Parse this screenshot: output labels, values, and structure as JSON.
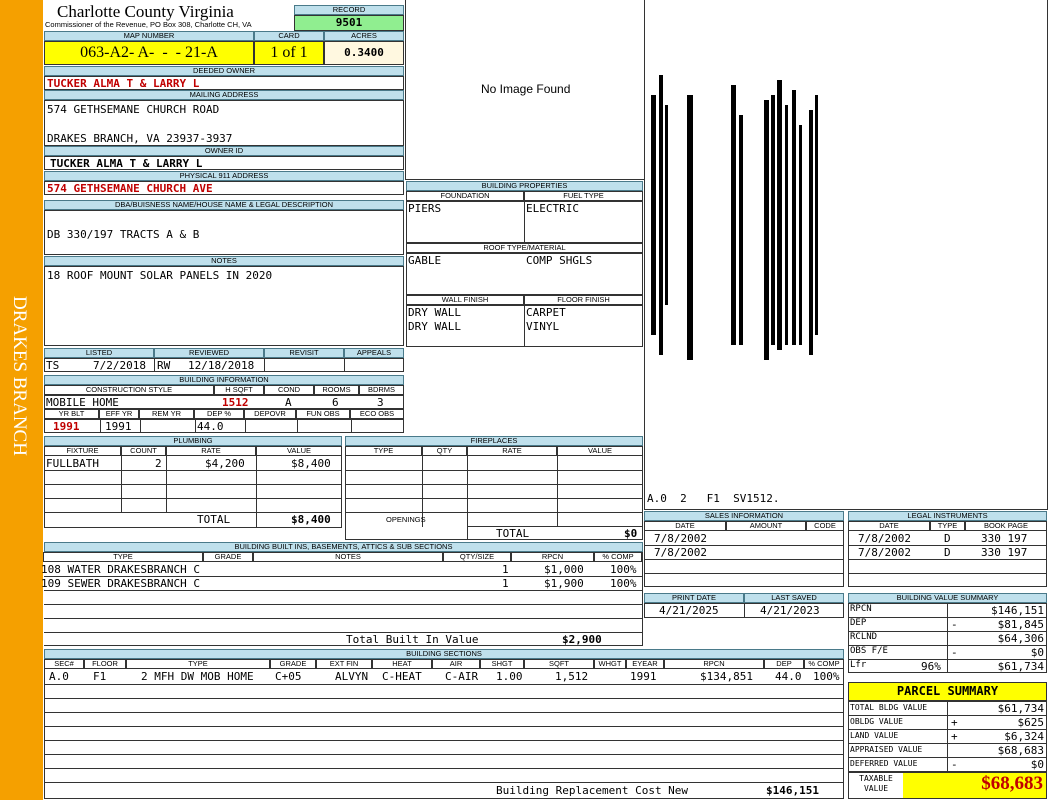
{
  "sidebar": {
    "text": "DRAKES BRANCH"
  },
  "county": {
    "title": "Charlotte County Virginia",
    "subtitle": "Commissioner of the Revenue, PO Box 308, Charlotte CH, VA"
  },
  "record": {
    "label": "RECORD",
    "value": "9501"
  },
  "map": {
    "label": "MAP NUMBER",
    "value": "063-A2- A-  -  - 21-A"
  },
  "card": {
    "label": "CARD",
    "value": "1 of 1"
  },
  "acres": {
    "label": "ACRES",
    "value": "0.3400"
  },
  "deeded_owner": {
    "label": "DEEDED OWNER",
    "value": "TUCKER ALMA T & LARRY L"
  },
  "mailing": {
    "label": "MAILING ADDRESS",
    "line1": "574 GETHSEMANE CHURCH ROAD",
    "line2": "DRAKES BRANCH, VA 23937-3937"
  },
  "owner_id": {
    "label": "OWNER ID",
    "value": "TUCKER ALMA T & LARRY L"
  },
  "physical": {
    "label": "PHYSICAL 911 ADDRESS",
    "value": "574 GETHSEMANE CHURCH AVE"
  },
  "legal": {
    "label": "DBA/BUISNESS NAME/HOUSE NAME & LEGAL DESCRIPTION",
    "value": "DB 330/197 TRACTS A & B"
  },
  "notes": {
    "label": "NOTES",
    "value": "18 ROOF MOUNT SOLAR PANELS IN 2020"
  },
  "photo": {
    "text": "No Image Found"
  },
  "building_props": {
    "label": "BUILDING PROPERTIES",
    "foundation_label": "FOUNDATION",
    "fuel_label": "FUEL TYPE",
    "foundation": "PIERS",
    "fuel": "ELECTRIC",
    "roof_label": "ROOF TYPE/MATERIAL",
    "roof_type": "GABLE",
    "roof_material": "COMP SHGLS",
    "wall_label": "WALL FINISH",
    "floor_label": "FLOOR FINISH",
    "walls": [
      "DRY WALL",
      "DRY WALL"
    ],
    "floors": [
      "CARPET",
      "VINYL"
    ]
  },
  "sketch": {
    "caption": "A.0  2   F1  SV1512."
  },
  "listed": {
    "label_listed": "LISTED",
    "label_reviewed": "REVIEWED",
    "label_revisit": "REVISIT",
    "label_appeals": "APPEALS",
    "listed_by": "TS",
    "listed_date": "7/2/2018",
    "reviewed_by": "RW",
    "reviewed_date": "12/18/2018"
  },
  "bldg_info": {
    "label": "BUILDING INFORMATION",
    "h_style": "CONSTRUCTION STYLE",
    "h_sqft": "H SQFT",
    "h_cond": "COND",
    "h_rooms": "ROOMS",
    "h_bdrms": "BDRMS",
    "style": "MOBILE HOME",
    "sqft": "1512",
    "cond": "A",
    "rooms": "6",
    "bdrms": "3",
    "h_yrblt": "YR BLT",
    "h_effyr": "EFF YR",
    "h_remyr": "REM YR",
    "h_dep": "DEP %",
    "h_depovr": "DEPOVR",
    "h_funobs": "FUN OBS",
    "h_ecoobs": "ECO OBS",
    "yrblt": "1991",
    "effyr": "1991",
    "dep": "44.0"
  },
  "plumbing": {
    "label": "PLUMBING",
    "headers": [
      "FIXTURE",
      "COUNT",
      "RATE",
      "VALUE"
    ],
    "rows": [
      {
        "fixture": "FULLBATH",
        "count": "2",
        "rate": "$4,200",
        "value": "$8,400"
      }
    ],
    "total_label": "TOTAL",
    "total": "$8,400"
  },
  "fireplaces": {
    "label": "FIREPLACES",
    "headers": [
      "TYPE",
      "QTY",
      "RATE",
      "VALUE"
    ],
    "openings_label": "OPENINGS",
    "total_label": "TOTAL",
    "total": "$0"
  },
  "sales": {
    "label": "SALES INFORMATION",
    "headers": [
      "DATE",
      "AMOUNT",
      "CODE"
    ],
    "rows": [
      {
        "date": "7/8/2002"
      },
      {
        "date": "7/8/2002"
      }
    ]
  },
  "legal_instr": {
    "label": "LEGAL INSTRUMENTS",
    "headers": [
      "DATE",
      "TYPE",
      "BOOK PAGE"
    ],
    "rows": [
      {
        "date": "7/8/2002",
        "type": "D",
        "book": "330 197"
      },
      {
        "date": "7/8/2002",
        "type": "D",
        "book": "330 197"
      }
    ]
  },
  "builtins": {
    "label": "BUILDING BUILT INS, BASEMENTS, ATTICS & SUB SECTIONS",
    "headers": [
      "TYPE",
      "GRADE",
      "NOTES",
      "QTY/SIZE",
      "RPCN",
      "% COMP"
    ],
    "rows": [
      {
        "type": "108 WATER DRAKESBRANCH C",
        "qty": "1",
        "rpcn": "$1,000",
        "comp": "100%"
      },
      {
        "type": "109 SEWER DRAKESBRANCH C",
        "qty": "1",
        "rpcn": "$1,900",
        "comp": "100%"
      }
    ],
    "total_label": "Total Built In Value",
    "total": "$2,900"
  },
  "print_date": {
    "label": "PRINT DATE",
    "value": "4/21/2025"
  },
  "last_saved": {
    "label": "LAST SAVED",
    "value": "4/21/2023"
  },
  "value_summary": {
    "label": "BUILDING VALUE SUMMARY",
    "rows": [
      {
        "name": "RPCN",
        "sign": "",
        "pct": "",
        "value": "$146,151"
      },
      {
        "name": "DEP",
        "sign": "-",
        "pct": "",
        "value": "$81,845"
      },
      {
        "name": "RCLND",
        "sign": "",
        "pct": "",
        "value": "$64,306"
      },
      {
        "name": "OBS F/E",
        "sign": "-",
        "pct": "",
        "value": "$0"
      },
      {
        "name": "Lfr",
        "sign": "",
        "pct": "96%",
        "value": "$61,734"
      }
    ]
  },
  "sections": {
    "label": "BUILDING SECTIONS",
    "headers": [
      "SEC#",
      "FLOOR",
      "TYPE",
      "GRADE",
      "EXT FIN",
      "HEAT",
      "AIR",
      "SHGT",
      "SQFT",
      "WHGT",
      "EYEAR",
      "RPCN",
      "DEP",
      "% COMP"
    ],
    "rows": [
      {
        "sec": "A.0",
        "floor": "F1",
        "type": "2 MFH DW MOB HOME",
        "grade": "C+05",
        "ext": "ALVYN",
        "heat": "C-HEAT",
        "air": "C-AIR",
        "shgt": "1.00",
        "sqft": "1,512",
        "whgt": "",
        "eyear": "1991",
        "rpcn": "$134,851",
        "dep": "44.0",
        "comp": "100%"
      }
    ],
    "replacement_label": "Building Replacement Cost New",
    "replacement": "$146,151"
  },
  "parcel": {
    "label": "PARCEL SUMMARY",
    "rows": [
      {
        "name": "TOTAL BLDG VALUE",
        "sign": "",
        "value": "$61,734"
      },
      {
        "name": "OBLDG VALUE",
        "sign": "+",
        "value": "$625"
      },
      {
        "name": "LAND VALUE",
        "sign": "+",
        "value": "$6,324"
      },
      {
        "name": "APPRAISED VALUE",
        "sign": "",
        "value": "$68,683"
      },
      {
        "name": "DEFERRED VALUE",
        "sign": "-",
        "value": "$0"
      }
    ],
    "taxable_label": "TAXABLE VALUE",
    "taxable": "$68,683"
  },
  "colors": {
    "sidebar": "#f5a000",
    "header_fill": "#bfe0ec",
    "map_fill": "#ffff00",
    "record_fill": "#90ee90",
    "accent_red": "#c00000"
  }
}
